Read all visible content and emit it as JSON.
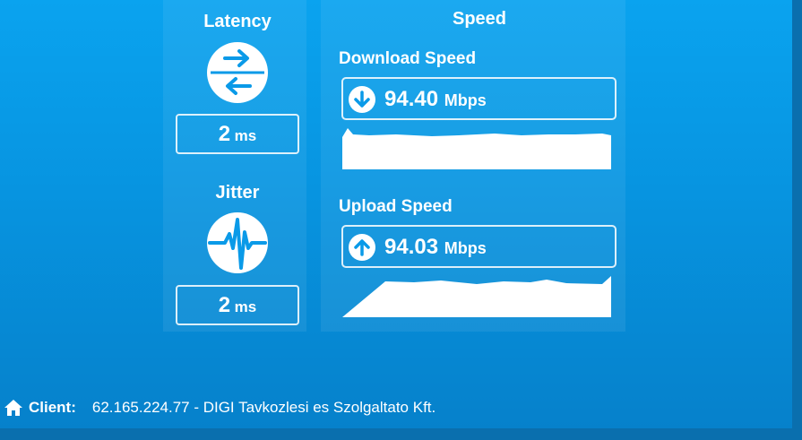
{
  "latency": {
    "title": "Latency",
    "value": "2",
    "unit": "ms",
    "icon": "latency-arrows-icon"
  },
  "jitter": {
    "title": "Jitter",
    "value": "2",
    "unit": "ms",
    "icon": "jitter-pulse-icon"
  },
  "speed": {
    "title": "Speed",
    "download": {
      "label": "Download Speed",
      "value": "94.40",
      "unit": "Mbps",
      "icon": "arrow-down-icon"
    },
    "upload": {
      "label": "Upload Speed",
      "value": "94.03",
      "unit": "Mbps",
      "icon": "arrow-up-icon"
    }
  },
  "client": {
    "label": "Client:",
    "info": "62.165.224.77 - DIGI Tavkozlesi es Szolgaltato Kft.",
    "icon": "home-icon"
  },
  "colors": {
    "background": "#0a9ae8",
    "foreground": "#ffffff"
  }
}
